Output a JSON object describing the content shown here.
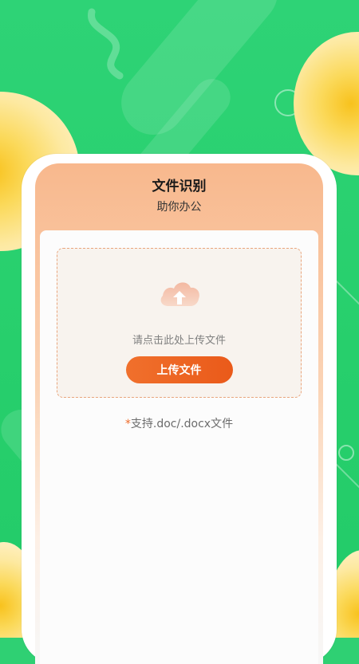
{
  "header": {
    "title": "文件识别",
    "subtitle": "助你办公"
  },
  "upload": {
    "icon": "cloud-upload-icon",
    "hint": "请点击此处上传文件",
    "button_label": "上传文件"
  },
  "support": {
    "mark": "*",
    "text": "支持.doc/.docx文件"
  },
  "colors": {
    "background_green": "#2fd073",
    "accent_orange": "#ee6b2a",
    "sun_yellow": "#f8c21d",
    "header_peach": "#f8b88d"
  }
}
